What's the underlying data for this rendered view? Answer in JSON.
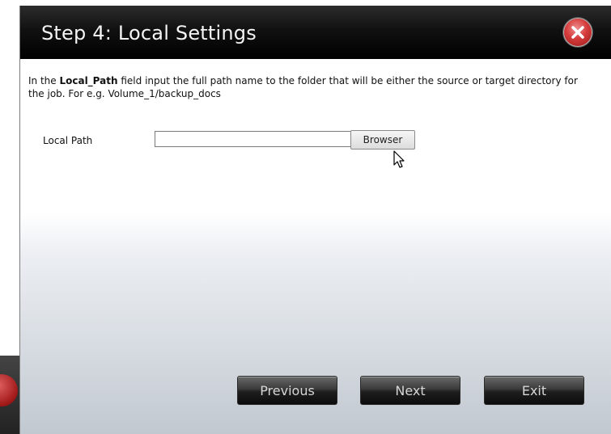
{
  "dialog": {
    "title": "Step 4: Local Settings",
    "close_icon": "close-icon"
  },
  "description": {
    "prefix": "In the ",
    "field_name": "Local_Path",
    "suffix": " field input the full path name to the folder that will be either the source or target directory for the job. For e.g. Volume_1/backup_docs"
  },
  "local_path": {
    "label": "Local Path",
    "value": "",
    "browse_label": "Browser"
  },
  "nav": {
    "previous_label": "Previous",
    "next_label": "Next",
    "exit_label": "Exit"
  },
  "colors": {
    "titlebar": "#000000",
    "close_button": "#d53c3c",
    "content_gradient_bottom": "#c2c8d0"
  }
}
